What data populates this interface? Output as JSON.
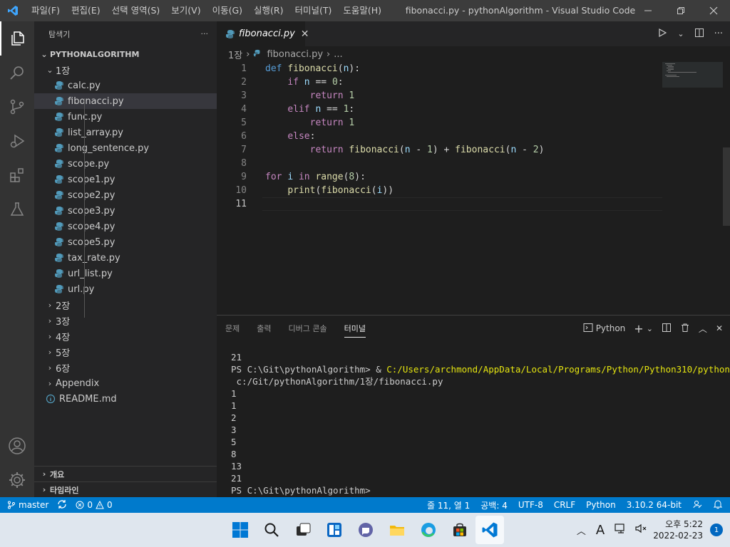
{
  "titlebar": {
    "menu": [
      "파일(F)",
      "편집(E)",
      "선택 영역(S)",
      "보기(V)",
      "이동(G)",
      "실행(R)",
      "터미널(T)",
      "도움말(H)"
    ],
    "title": "fibonacci.py - pythonAlgorithm - Visual Studio Code"
  },
  "sidebar": {
    "header": "탐색기",
    "more": "···",
    "root": "PYTHONALGORITHM",
    "folder_open": "1장",
    "files": [
      "calc.py",
      "fibonacci.py",
      "func.py",
      "list_array.py",
      "long_sentence.py",
      "scope.py",
      "scope1.py",
      "scope2.py",
      "scope3.py",
      "scope4.py",
      "scope5.py",
      "tax_rate.py",
      "url_list.py",
      "url.py"
    ],
    "folders_closed": [
      "2장",
      "3장",
      "4장",
      "5장",
      "6장",
      "Appendix"
    ],
    "readme": "README.md",
    "outline": "개요",
    "timeline": "타임라인"
  },
  "editor": {
    "tab": "fibonacci.py",
    "breadcrumb": [
      "1장",
      "fibonacci.py",
      "..."
    ],
    "line_numbers": [
      "1",
      "2",
      "3",
      "4",
      "5",
      "6",
      "7",
      "8",
      "9",
      "10",
      "11"
    ]
  },
  "panel": {
    "tabs": [
      "문제",
      "출력",
      "디버그 콘솔",
      "터미널"
    ],
    "shell": "Python",
    "terminal": {
      "line0": "21",
      "prompt1": "PS C:\\Git\\pythonAlgorithm> & ",
      "exe": "C:/Users/archmond/AppData/Local/Programs/Python/Python310/python.exe",
      "arg": " c:/Git/pythonAlgorithm/1장/fibonacci.py",
      "outputs": [
        "1",
        "1",
        "2",
        "3",
        "5",
        "8",
        "13",
        "21"
      ],
      "prompt2": "PS C:\\Git\\pythonAlgorithm>"
    }
  },
  "statusbar": {
    "branch": "master",
    "errors": "0",
    "warnings": "0",
    "position": "줄 11, 열 1",
    "spaces": "공백: 4",
    "encoding": "UTF-8",
    "eol": "CRLF",
    "language": "Python",
    "interpreter": "3.10.2 64-bit"
  },
  "taskbar": {
    "ime": "A",
    "time": "오후 5:22",
    "date": "2022-02-23",
    "notifications": "1"
  },
  "colors": {
    "accent": "#007acc",
    "keyword": "#569cd6",
    "control": "#c586c0",
    "function": "#dcdcaa",
    "variable": "#9cdcfe",
    "number": "#b5cea8"
  }
}
